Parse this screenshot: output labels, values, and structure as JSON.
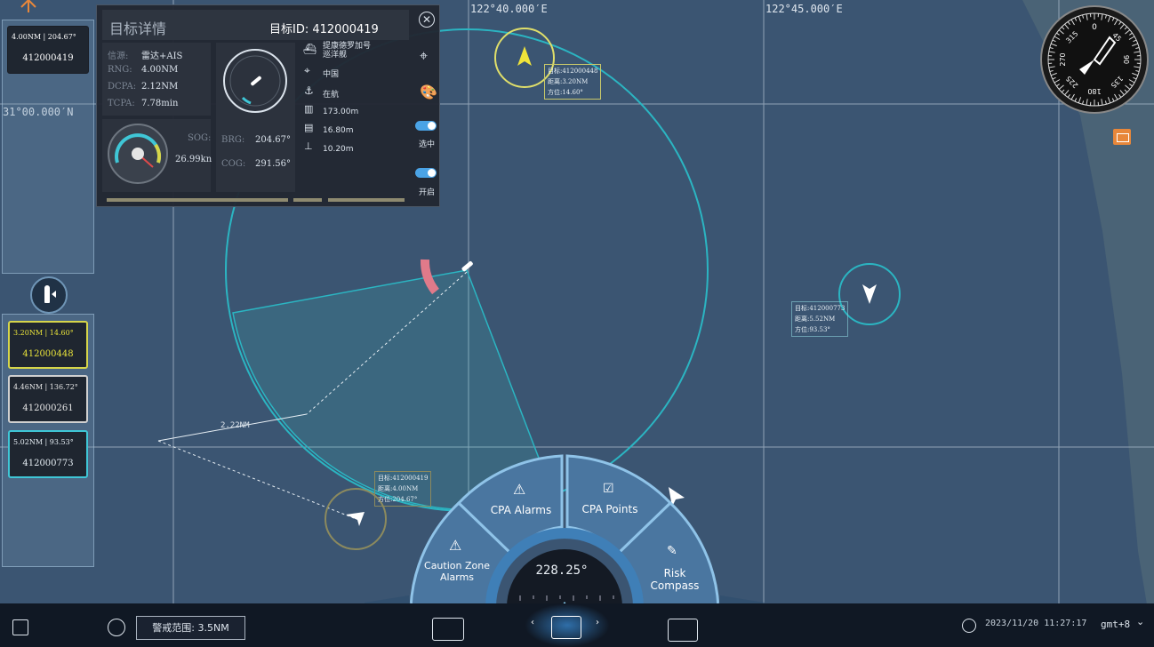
{
  "coords": {
    "lon1": "122°40.000′E",
    "lon2": "122°45.000′E",
    "lat1": "31°00.000′N"
  },
  "detail": {
    "title": "目标详情",
    "target_id": "目标ID: 412000419",
    "source_key": "信源:",
    "source_val": "雷达+AIS",
    "rng_key": "RNG:",
    "rng_val": "4.00NM",
    "dcpa_key": "DCPA:",
    "dcpa_val": "2.12NM",
    "tcpa_key": "TCPA:",
    "tcpa_val": "7.78min",
    "sog_key": "SOG:",
    "sog_val": "26.99kn",
    "brg_key": "BRG:",
    "brg_val": "204.67°",
    "cog_key": "COG:",
    "cog_val": "291.56°",
    "ship_name": "提康德罗加号巡洋舰",
    "country": "中国",
    "status": "在航",
    "length": "173.00m",
    "beam": "16.80m",
    "draft": "10.20m",
    "toggle1_label": "选中",
    "toggle2_label": "开启"
  },
  "left_top_card": {
    "line1": "4.00NM | 204.67°",
    "line2": "412000419"
  },
  "cards": [
    {
      "line1": "3.20NM | 14.60°",
      "line2": "412000448",
      "color": "#e8e23a"
    },
    {
      "line1": "4.46NM | 136.72°",
      "line2": "412000261",
      "color": "#e6e6e6"
    },
    {
      "line1": "5.02NM | 93.53°",
      "line2": "412000773",
      "color": "#3fc6d6"
    }
  ],
  "targets": {
    "t448": [
      "目标:412000448",
      "距离:3.20NM",
      "方位:14.60°"
    ],
    "t773": [
      "目标:412000773",
      "距离:5.52NM",
      "方位:93.53°"
    ],
    "t419": [
      "目标:412000419",
      "距离:4.00NM",
      "方位:204.67°"
    ]
  },
  "dcpa_line_label": "2.22NM",
  "compass": {
    "n": "0",
    "labels": [
      "45",
      "90",
      "135",
      "180",
      "225",
      "270",
      "315"
    ]
  },
  "dial": {
    "cpa_alarms": "CPA Alarms",
    "cpa_points": "CPA Points",
    "caution_zone": "Caution Zone Alarms",
    "risk_compass": "Risk Compass",
    "heading": "228.25°"
  },
  "bottom": {
    "range_label": "警戒范围: 3.5NM",
    "datetime": "2023/11/20 11:27:17",
    "timezone": "gmt+8"
  },
  "colors": {
    "accent": "#4aa3e6",
    "teal": "#3fc6d6",
    "yellow": "#e8e23a"
  }
}
